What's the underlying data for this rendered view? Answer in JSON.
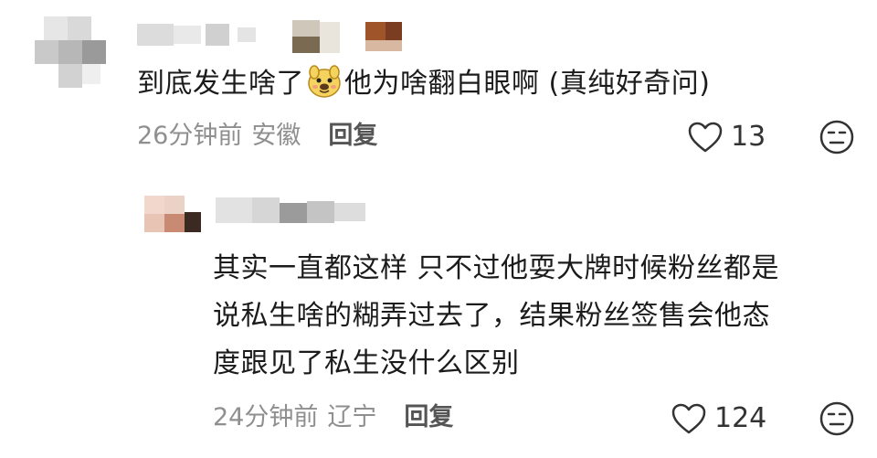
{
  "comments": [
    {
      "text_before_emoji": "到底发生啥了",
      "emoji": "dog-face-emoji",
      "text_after_emoji": "他为啥翻白眼啊 (真纯好奇问)",
      "time": "26分钟前",
      "location": "安徽",
      "reply_label": "回复",
      "likes": "13"
    },
    {
      "text_lines": [
        "其实一直都这样 只不过他耍大牌时候粉丝都是",
        "说私生啥的糊弄过去了，结果粉丝签售会他态",
        "度跟见了私生没什么区别"
      ],
      "time": "24分钟前",
      "location": "辽宁",
      "reply_label": "回复",
      "likes": "124"
    }
  ],
  "icons": {
    "like": "heart-outline-icon",
    "dislike": "meh-face-icon"
  },
  "colors": {
    "text": "#1b1b1b",
    "meta": "#8f8f8f",
    "icon": "#333333"
  }
}
